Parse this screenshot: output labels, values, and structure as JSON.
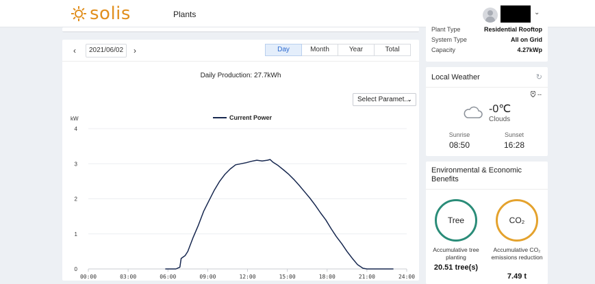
{
  "brand": {
    "name": "solis",
    "color": "#e18f1e"
  },
  "nav": {
    "plants_label": "Plants"
  },
  "user": {
    "menu_chevron": "⌄"
  },
  "date_nav": {
    "prev": "‹",
    "date": "2021/06/02",
    "next": "›"
  },
  "tabs": [
    {
      "label": "Day",
      "active": true
    },
    {
      "label": "Month",
      "active": false
    },
    {
      "label": "Year",
      "active": false
    },
    {
      "label": "Total",
      "active": false
    }
  ],
  "production": {
    "title": "Daily Production: 27.7kWh"
  },
  "select_parameter": {
    "label": "Select Paramet...",
    "chevron": "⌄"
  },
  "chart_data": {
    "type": "line",
    "title": "",
    "ylabel": "kW",
    "xlabel": "",
    "legend": "Current Power",
    "legend_position": "top-center",
    "ylim": [
      0,
      4
    ],
    "yticks": [
      "0",
      "1",
      "2",
      "3",
      "4"
    ],
    "xlim": [
      0,
      24
    ],
    "xticks": [
      "00:00",
      "03:00",
      "06:00",
      "09:00",
      "12:00",
      "15:00",
      "18:00",
      "21:00",
      "24:00"
    ],
    "grid": "horizontal",
    "line_color": "#15264e",
    "series": [
      {
        "name": "Current Power",
        "x": [
          5.8,
          6.2,
          6.6,
          6.9,
          7.0,
          7.3,
          7.5,
          7.9,
          8.3,
          8.7,
          9.1,
          9.5,
          9.9,
          10.3,
          10.7,
          11.1,
          11.5,
          11.9,
          12.3,
          12.7,
          13.1,
          13.5,
          13.7,
          13.9,
          14.3,
          14.7,
          15.1,
          15.5,
          15.9,
          16.3,
          16.7,
          17.1,
          17.5,
          17.9,
          18.3,
          18.7,
          19.1,
          19.5,
          19.9,
          20.3,
          20.7,
          21.0,
          21.5,
          22.0,
          22.5,
          23.0
        ],
        "y": [
          0.0,
          0.0,
          0.0,
          0.05,
          0.3,
          0.38,
          0.5,
          0.9,
          1.25,
          1.65,
          1.95,
          2.25,
          2.5,
          2.7,
          2.85,
          2.97,
          3.0,
          3.03,
          3.07,
          3.1,
          3.08,
          3.1,
          3.12,
          3.05,
          2.95,
          2.83,
          2.7,
          2.55,
          2.38,
          2.2,
          2.02,
          1.82,
          1.6,
          1.4,
          1.15,
          0.92,
          0.72,
          0.5,
          0.3,
          0.12,
          0.02,
          0.0,
          0.0,
          0.0,
          0.0,
          0.0
        ]
      }
    ]
  },
  "plant_info": [
    {
      "key": "Plant Type",
      "value": "Residential Rooftop"
    },
    {
      "key": "System Type",
      "value": "All on Grid"
    },
    {
      "key": "Capacity",
      "value": "4.27kWp"
    }
  ],
  "weather": {
    "title": "Local Weather",
    "refresh_icon": "↻",
    "location": "--",
    "temperature": "-0℃",
    "condition": "Clouds",
    "sunrise_label": "Sunrise",
    "sunrise": "08:50",
    "sunset_label": "Sunset",
    "sunset": "16:28"
  },
  "benefits": {
    "title": "Environmental & Economic Benefits",
    "tree_ring": "Tree",
    "tree_label": "Accumulative tree planting",
    "tree_value": "20.51 tree(s)",
    "co2_ring": "CO₂",
    "co2_label": "Accumulative CO₂ emissions reduction",
    "co2_value": "7.49 t",
    "tree_color": "#2a8c78",
    "co2_color": "#e4a22d"
  }
}
